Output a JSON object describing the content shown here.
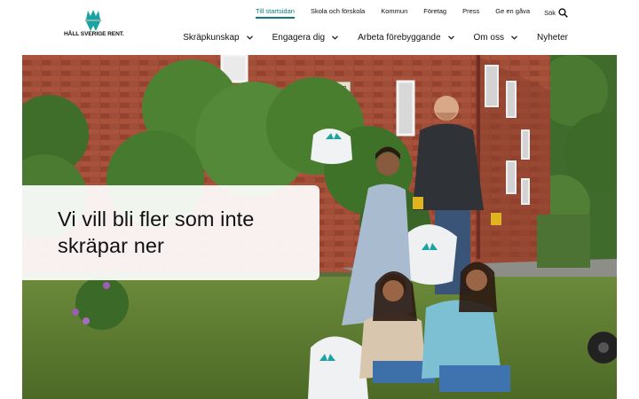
{
  "brand": {
    "logo_text": "HÅLL SVERIGE RENT."
  },
  "top_nav": {
    "items": [
      "Till startsidan",
      "Skola och förskola",
      "Kommun",
      "Företag",
      "Press",
      "Ge en gåva"
    ],
    "search_label": "Sök"
  },
  "main_nav": {
    "items": [
      {
        "label": "Skräpkunskap",
        "has_dropdown": true
      },
      {
        "label": "Engagera dig",
        "has_dropdown": true
      },
      {
        "label": "Arbeta förebyggande",
        "has_dropdown": true
      },
      {
        "label": "Om oss",
        "has_dropdown": true
      },
      {
        "label": "Nyheter",
        "has_dropdown": false
      }
    ]
  },
  "hero": {
    "headline": "Vi vill bli fler som inte skräpar ner",
    "house_number": "27"
  },
  "colors": {
    "accent": "#0b7a7a",
    "brick": "#9c4a35",
    "grass": "#5b7a32"
  }
}
